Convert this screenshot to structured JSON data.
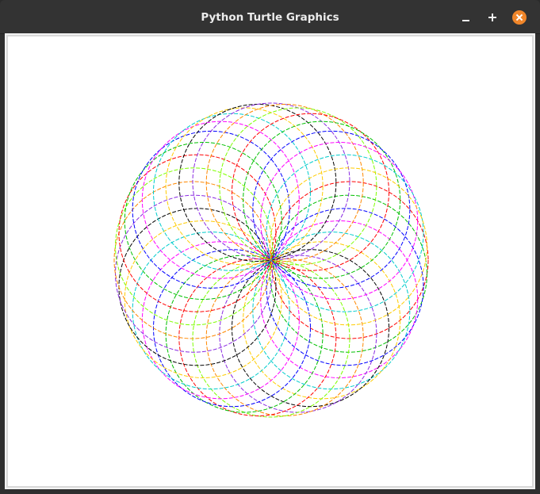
{
  "window": {
    "title": "Python Turtle Graphics"
  },
  "controls": {
    "minimize": "minimize-icon",
    "maximize": "plus-icon",
    "close": "close-icon",
    "close_color": "#f0862a"
  },
  "colors": {
    "titlebar": "#333333",
    "canvas_background": "#ffffff",
    "circle_palette": [
      "#ff0000",
      "#00c000",
      "#0000ff",
      "#ff00ff",
      "#00cccc",
      "#ffcc00",
      "#000000",
      "#8a2be2",
      "#ff8800",
      "#7fff00"
    ]
  },
  "drawing": {
    "shape": "circle",
    "circle_count": 36
  }
}
